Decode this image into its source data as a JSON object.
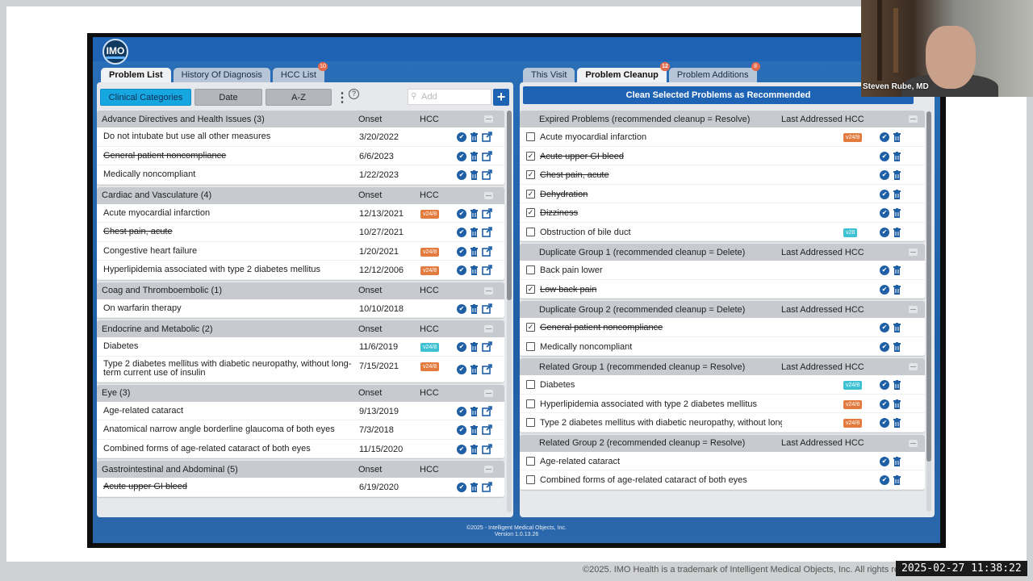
{
  "app": {
    "logo_text": "IMO",
    "copyright_line1": "©2025 - Intelligent Medical Objects, Inc.",
    "copyright_line2": "Version 1.0.13.26"
  },
  "left_tabs": [
    {
      "label": "Problem List",
      "active": true,
      "badge": ""
    },
    {
      "label": "History Of Diagnosis",
      "active": false,
      "badge": ""
    },
    {
      "label": "HCC List",
      "active": false,
      "badge": "10"
    }
  ],
  "right_tabs": [
    {
      "label": "This Visit",
      "active": false,
      "badge": ""
    },
    {
      "label": "Problem Cleanup",
      "active": true,
      "badge": "12"
    },
    {
      "label": "Problem Additions",
      "active": false,
      "badge": "8"
    }
  ],
  "toolbar": {
    "clinical_categories": "Clinical Categories",
    "date": "Date",
    "az": "A-Z",
    "kebab": "⋮",
    "help": "?",
    "add_placeholder": "Add",
    "add_button": "+"
  },
  "columns": {
    "onset": "Onset",
    "hcc": "HCC",
    "last_addressed": "Last Addressed HCC"
  },
  "left_groups": [
    {
      "title": "Advance Directives and Health Issues (3)",
      "items": [
        {
          "name": "Do not intubate but use all other measures",
          "onset": "3/20/2022",
          "hcc": "",
          "struck": false
        },
        {
          "name": "General patient noncompliance",
          "onset": "6/6/2023",
          "hcc": "",
          "struck": true
        },
        {
          "name": "Medically noncompliant",
          "onset": "1/22/2023",
          "hcc": "",
          "struck": false
        }
      ]
    },
    {
      "title": "Cardiac and Vasculature (4)",
      "items": [
        {
          "name": "Acute myocardial infarction",
          "onset": "12/13/2021",
          "hcc": "v24/8",
          "hcc_color": "orange",
          "struck": false
        },
        {
          "name": "Chest pain, acute",
          "onset": "10/27/2021",
          "hcc": "",
          "struck": true
        },
        {
          "name": "Congestive heart failure",
          "onset": "1/20/2021",
          "hcc": "v24/8",
          "hcc_color": "orange",
          "struck": false
        },
        {
          "name": "Hyperlipidemia associated with type 2 diabetes mellitus",
          "onset": "12/12/2006",
          "hcc": "v24/8",
          "hcc_color": "orange",
          "struck": false
        }
      ]
    },
    {
      "title": "Coag and Thromboembolic (1)",
      "items": [
        {
          "name": "On warfarin therapy",
          "onset": "10/10/2018",
          "hcc": "",
          "struck": false
        }
      ]
    },
    {
      "title": "Endocrine and Metabolic (2)",
      "items": [
        {
          "name": "Diabetes",
          "onset": "11/6/2019",
          "hcc": "v24/8",
          "hcc_color": "teal",
          "struck": false
        },
        {
          "name": "Type 2 diabetes mellitus with diabetic neuropathy, without long-term current use of insulin",
          "onset": "7/15/2021",
          "hcc": "v24/8",
          "hcc_color": "orange",
          "struck": false,
          "tall": true
        }
      ]
    },
    {
      "title": "Eye (3)",
      "items": [
        {
          "name": "Age-related cataract",
          "onset": "9/13/2019",
          "hcc": "",
          "struck": false
        },
        {
          "name": "Anatomical narrow angle borderline glaucoma of both eyes",
          "onset": "7/3/2018",
          "hcc": "",
          "struck": false
        },
        {
          "name": "Combined forms of age-related cataract of both eyes",
          "onset": "11/15/2020",
          "hcc": "",
          "struck": false
        }
      ]
    },
    {
      "title": "Gastrointestinal and Abdominal (5)",
      "items": [
        {
          "name": "Acute upper GI bleed",
          "onset": "6/19/2020",
          "hcc": "",
          "struck": true
        }
      ]
    }
  ],
  "clean_button": "Clean Selected Problems as Recommended",
  "right_groups": [
    {
      "title": "Expired Problems (recommended cleanup = Resolve)",
      "items": [
        {
          "name": "Acute myocardial infarction",
          "checked": false,
          "hcc": "v24/8",
          "hcc_color": "orange"
        },
        {
          "name": "Acute upper GI bleed",
          "checked": true,
          "hcc": ""
        },
        {
          "name": "Chest pain, acute",
          "checked": true,
          "hcc": ""
        },
        {
          "name": "Dehydration",
          "checked": true,
          "hcc": ""
        },
        {
          "name": "Dizziness",
          "checked": true,
          "hcc": ""
        },
        {
          "name": "Obstruction of bile duct",
          "checked": false,
          "hcc": "v28",
          "hcc_color": "teal"
        }
      ]
    },
    {
      "title": "Duplicate Group 1 (recommended cleanup = Delete)",
      "items": [
        {
          "name": "Back pain lower",
          "checked": false,
          "hcc": ""
        },
        {
          "name": "Low back pain",
          "checked": true,
          "hcc": ""
        }
      ]
    },
    {
      "title": "Duplicate Group 2 (recommended cleanup = Delete)",
      "items": [
        {
          "name": "General patient noncompliance",
          "checked": true,
          "hcc": ""
        },
        {
          "name": "Medically noncompliant",
          "checked": false,
          "hcc": ""
        }
      ]
    },
    {
      "title": "Related Group 1 (recommended cleanup = Resolve)",
      "items": [
        {
          "name": "Diabetes",
          "checked": false,
          "hcc": "v24/8",
          "hcc_color": "teal"
        },
        {
          "name": "Hyperlipidemia associated with type 2 diabetes mellitus",
          "checked": false,
          "hcc": "v24/8",
          "hcc_color": "orange"
        },
        {
          "name": "Type 2 diabetes mellitus with diabetic neuropathy, without long-",
          "checked": false,
          "hcc": "v24/8",
          "hcc_color": "orange"
        }
      ]
    },
    {
      "title": "Related Group 2 (recommended cleanup = Resolve)",
      "items": [
        {
          "name": "Age-related cataract",
          "checked": false,
          "hcc": ""
        },
        {
          "name": "Combined forms of age-related cataract of both eyes",
          "checked": false,
          "hcc": ""
        }
      ]
    }
  ],
  "overlay": {
    "presenter": "Steven Rube, MD",
    "footer": "©2025. IMO Health is a trademark of Intelligent Medical Objects, Inc. All rights re",
    "timestamp": "2025-02-27  11:38:22"
  },
  "colors": {
    "brand_blue": "#1f64b4",
    "selected": "#17a7e0",
    "hcc_orange": "#e27b3d",
    "hcc_teal": "#3ec1d3"
  }
}
